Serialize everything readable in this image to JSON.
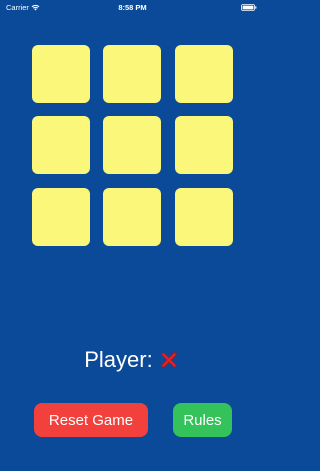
{
  "status_bar": {
    "carrier": "Carrier",
    "time": "8:58 PM",
    "wifi_icon": "wifi-icon",
    "battery_icon": "battery-icon"
  },
  "board": {
    "cell_color": "#fbf77a",
    "cells": [
      "",
      "",
      "",
      "",
      "",
      "",
      "",
      "",
      ""
    ]
  },
  "player": {
    "label": "Player:",
    "current_mark_icon": "red-x-icon",
    "mark_color": "#e0242b"
  },
  "buttons": {
    "reset_label": "Reset Game",
    "reset_color": "#f2413d",
    "rules_label": "Rules",
    "rules_color": "#34c25a"
  },
  "theme": {
    "background": "#0b4a99"
  }
}
